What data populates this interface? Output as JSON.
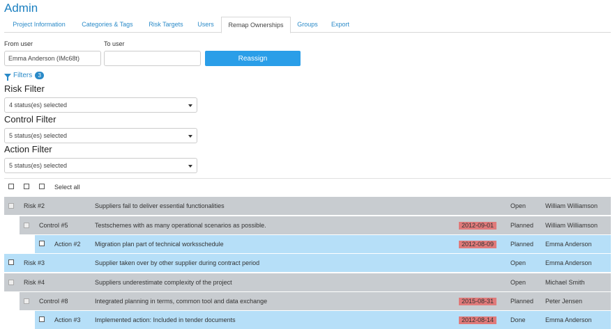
{
  "page": {
    "title": "Admin"
  },
  "tabs": [
    {
      "label": "Project Information",
      "active": false
    },
    {
      "label": "Categories & Tags",
      "active": false
    },
    {
      "label": "Risk Targets",
      "active": false
    },
    {
      "label": "Users",
      "active": false
    },
    {
      "label": "Remap Ownerships",
      "active": true
    },
    {
      "label": "Groups",
      "active": false
    },
    {
      "label": "Export",
      "active": false
    }
  ],
  "reassign": {
    "from_label": "From user",
    "from_value": "Emma Anderson (IMc68t)",
    "to_label": "To user",
    "to_value": "",
    "button_label": "Reassign"
  },
  "filters": {
    "label": "Filters",
    "count": "3",
    "risk": {
      "title": "Risk Filter",
      "selected": "4 status(es) selected"
    },
    "control": {
      "title": "Control Filter",
      "selected": "5 status(es) selected"
    },
    "action": {
      "title": "Action Filter",
      "selected": "5 status(es) selected"
    }
  },
  "list": {
    "select_all_label": "Select all",
    "rows": [
      {
        "type": "risk",
        "id": "Risk #2",
        "desc": "Suppliers fail to deliver essential functionalities",
        "date": "",
        "status": "Open",
        "owner": "William Williamson",
        "color": "gray"
      },
      {
        "type": "control",
        "id": "Control #5",
        "desc": "Testschemes with as many operational scenarios as possible.",
        "date": "2012-09-01",
        "status": "Planned",
        "owner": "William Williamson",
        "color": "gray"
      },
      {
        "type": "action",
        "id": "Action #2",
        "desc": "Migration plan part of technical worksschedule",
        "date": "2012-08-09",
        "status": "Planned",
        "owner": "Emma Anderson",
        "color": "blue"
      },
      {
        "type": "risk",
        "id": "Risk #3",
        "desc": "Supplier taken over by other supplier during contract period",
        "date": "",
        "status": "Open",
        "owner": "Emma Anderson",
        "color": "blue"
      },
      {
        "type": "risk",
        "id": "Risk #4",
        "desc": "Suppliers underestimate complexity of the project",
        "date": "",
        "status": "Open",
        "owner": "Michael Smith",
        "color": "gray"
      },
      {
        "type": "control",
        "id": "Control #8",
        "desc": "Integrated planning in terms, common tool and data exchange",
        "date": "2015-08-31",
        "status": "Planned",
        "owner": "Peter Jensen",
        "color": "gray"
      },
      {
        "type": "action",
        "id": "Action #3",
        "desc": "Implemented action: Included in tender documents",
        "date": "2012-08-14",
        "status": "Done",
        "owner": "Emma Anderson",
        "color": "blue"
      }
    ]
  },
  "colors": {
    "accent": "#2a9ee8",
    "link": "#2a8ac8",
    "row_gray": "#c8ccd0",
    "row_blue": "#b6dff8",
    "date_overdue": "#e07a7a"
  }
}
